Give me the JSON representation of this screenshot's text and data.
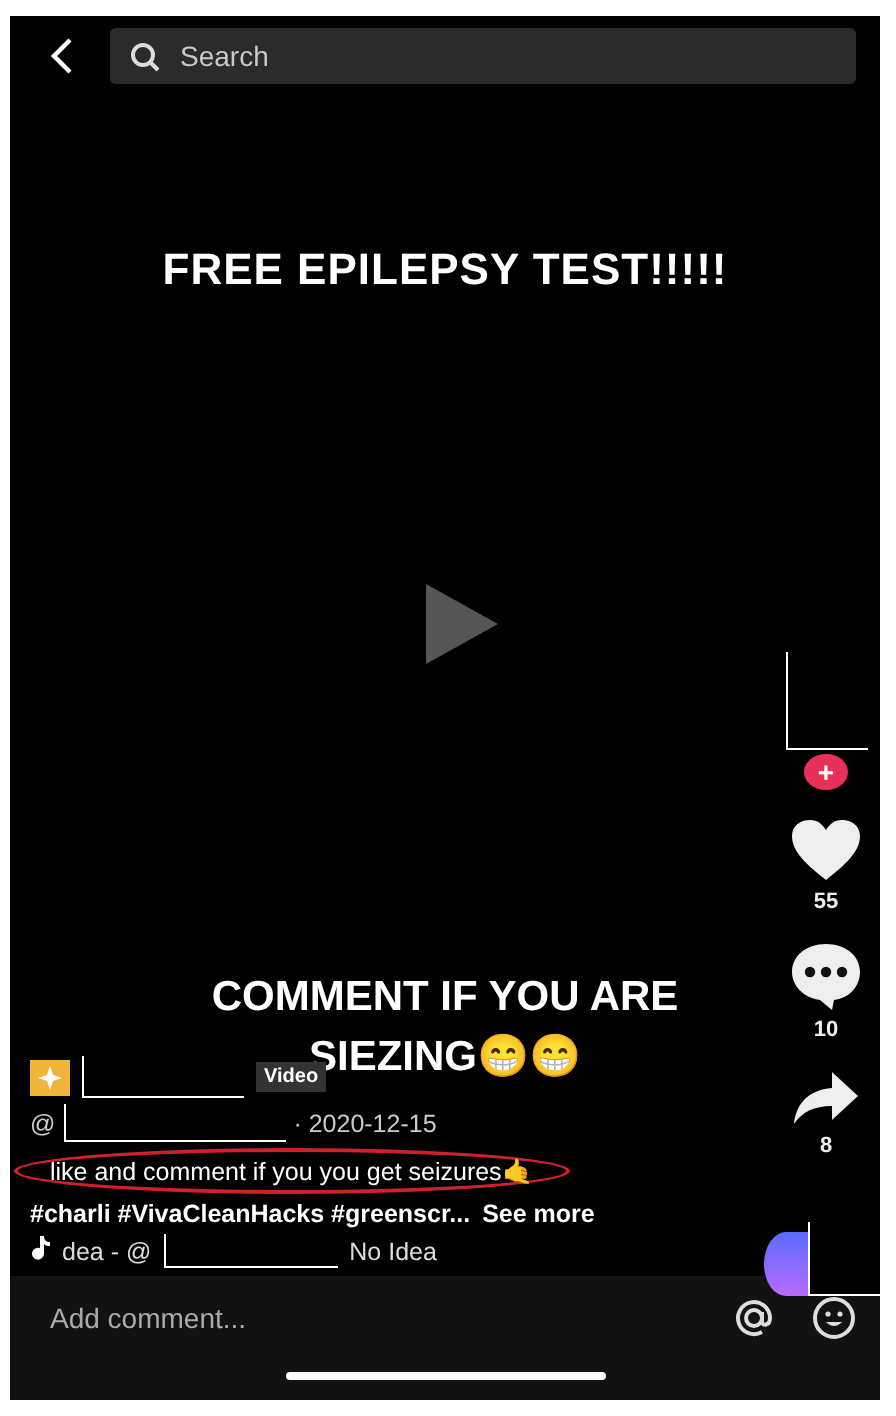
{
  "search": {
    "placeholder": "Search"
  },
  "video": {
    "headline": "FREE EPILEPSY TEST!!!!!",
    "overlay_lines": [
      "COMMENT IF YOU ARE",
      "SIEZING😁😁"
    ]
  },
  "follow": "+",
  "actions": [
    {
      "kind": "like",
      "count": "55"
    },
    {
      "kind": "comment",
      "count": "10"
    },
    {
      "kind": "share",
      "count": "8"
    }
  ],
  "post": {
    "tag": "Video",
    "handle_prefix": "@",
    "date": "· 2020-12-15",
    "caption": "like and comment if you you get seizures🤙",
    "hashtags": "#charli #VivaCleanHacks #greenscr...",
    "see_more": "See more",
    "sound": "dea - @",
    "sound_title": "No Idea"
  },
  "comment_bar": {
    "placeholder": "Add comment..."
  }
}
